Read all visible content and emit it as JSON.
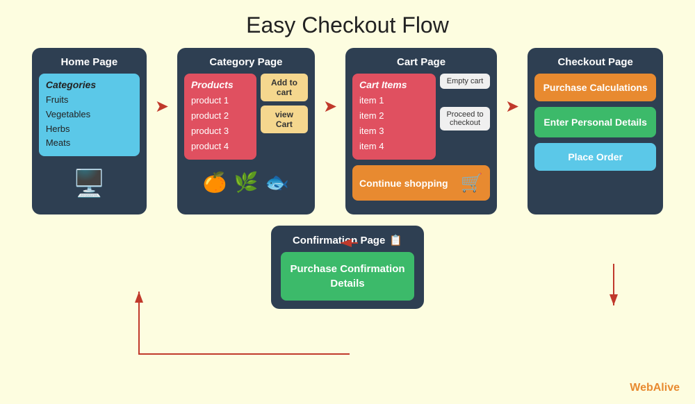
{
  "title": "Easy Checkout Flow",
  "pages": {
    "home": {
      "title": "Home Page",
      "categories_title": "Categories",
      "categories": [
        "Fruits",
        "Vegetables",
        "Herbs",
        "Meats"
      ]
    },
    "category": {
      "title": "Category Page",
      "products_title": "Products",
      "products": [
        "product 1",
        "product 2",
        "product 3",
        "product 4"
      ],
      "btn_add": "Add to cart",
      "btn_view": "view Cart"
    },
    "cart": {
      "title": "Cart Page",
      "items_title": "Cart Items",
      "items": [
        "item 1",
        "item 2",
        "item 3",
        "item 4"
      ],
      "btn_empty": "Empty cart",
      "btn_proceed": "Proceed to checkout",
      "btn_continue": "Continue shopping"
    },
    "checkout": {
      "title": "Checkout Page",
      "btn_calculations": "Purchase Calculations",
      "btn_personal": "Enter Personal Details",
      "btn_order": "Place Order"
    },
    "confirmation": {
      "title": "Confirmation Page",
      "details": "Purchase Confirmation Details"
    }
  },
  "branding": {
    "web": "Web",
    "alive": "Alive"
  }
}
